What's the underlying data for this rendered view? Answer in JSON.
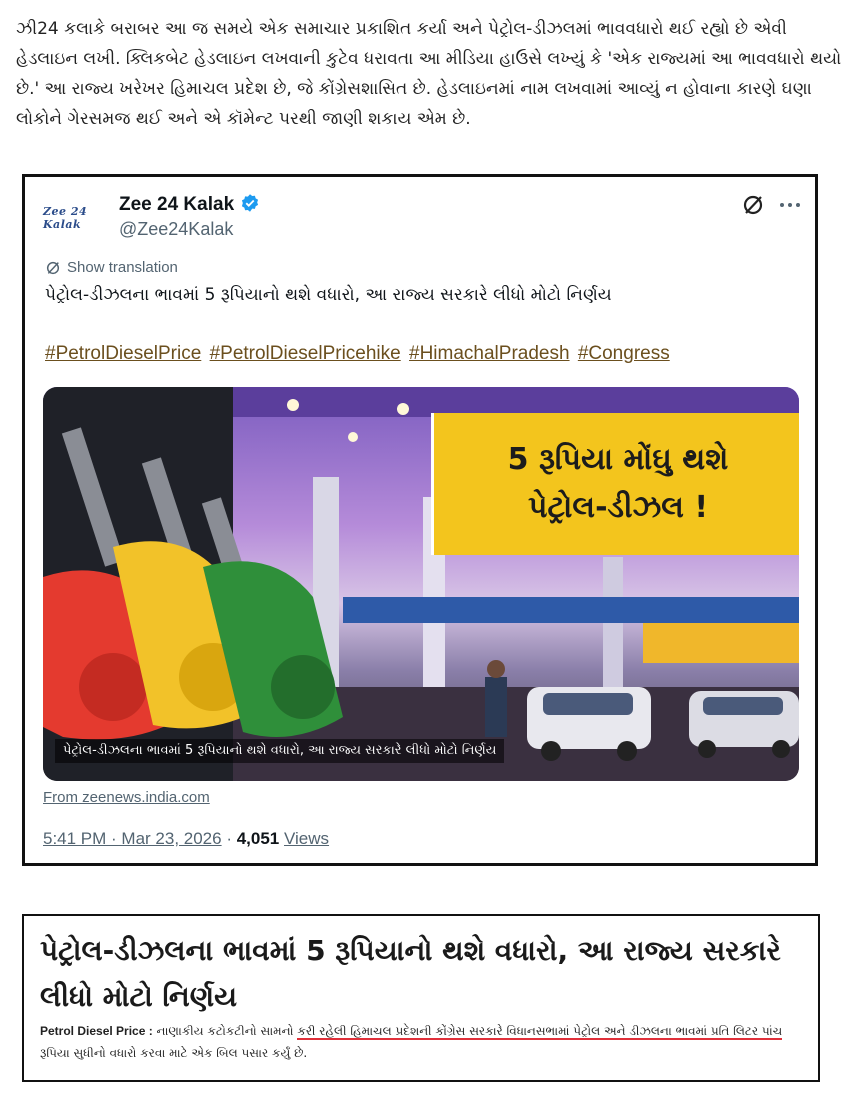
{
  "intro_paragraph": "ઝી24 કલાકે બરાબર આ જ સમયે એક સમાચાર પ્રકાશિત કર્યા અને પેટ્રોલ-ડીઝલમાં ભાવવધારો થઈ રહ્યો છે એવી હેડલાઇન લખી. ક્લિકબેટ હેડલાઇન લખવાની કુટેવ ધરાવતા આ મીડિયા હાઉસે લખ્યું કે 'એક રાજ્યમાં આ ભાવવધારો થયો છે.' આ રાજ્ય ખરેખર હિમાચલ પ્રદેશ છે, જે કોંગ્રેસશાસિત છે. હેડલાઇનમાં નામ લખવામાં આવ્યું ન હોવાના કારણે ઘણા લોકોને ગેરસમજ થઈ અને એ કૉમેન્ટ પરથી જાણી શકાય એમ છે.",
  "tweet": {
    "avatar_text": "Zee 24 Kalak",
    "account_name": "Zee 24 Kalak",
    "handle": "@Zee24Kalak",
    "show_translation": "Show translation",
    "text": "પેટ્રોલ-ડીઝલના ભાવમાં 5 રૂપિયાનો થશે વધારો, આ રાજ્ય સરકારે લીધો મોટો નિર્ણય",
    "hashtags": [
      "#PetrolDieselPrice",
      "#PetrolDieselPricehike",
      "#HimachalPradesh",
      "#Congress"
    ],
    "media": {
      "banner_line1": "5 રૂપિયા મોંઘુ થશે",
      "banner_line2": "પેટ્રોલ-ડીઝલ !",
      "caption": "પેટ્રોલ-ડીઝલના ભાવમાં 5 રૂપિયાનો થશે વધારો, આ રાજ્ય સરકારે લીધો મોટો નિર્ણય"
    },
    "source": "From zeenews.india.com",
    "timestamp": "5:41 PM · Mar 23, 2026",
    "views_count": "4,051",
    "views_label": "Views",
    "icons": [
      "verified-badge-icon",
      "grok-icon",
      "more-options-icon",
      "translate-icon"
    ]
  },
  "article": {
    "title": "પેટ્રોલ-ડીઝલના ભાવમાં 5 રૂપિયાનો થશે વધારો, આ રાજ્ય સરકારે લીધો મોટો નિર્ણય",
    "label": "Petrol Diesel Price :",
    "body_pre": "નાણાકીય કટોકટીનો સામનો ",
    "body_underlined": "કરી રહેલી હિમાચલ પ્રદેશની કોંગ્રેસ સરકારે વિધાનસભામાં પેટ્રોલ અને ડીઝલના ભાવમાં પ્રતિ લિટર પાંચ",
    "body_post": " રૂપિયા સુધીનો વધારો કરવા માટે એક બિલ પસાર કર્યું છે."
  },
  "colors": {
    "banner_yellow": "#f3c51d",
    "hashtag_brown": "#6b4f1e",
    "verified_blue": "#1d9bf0",
    "underline_red": "#e0303a"
  }
}
